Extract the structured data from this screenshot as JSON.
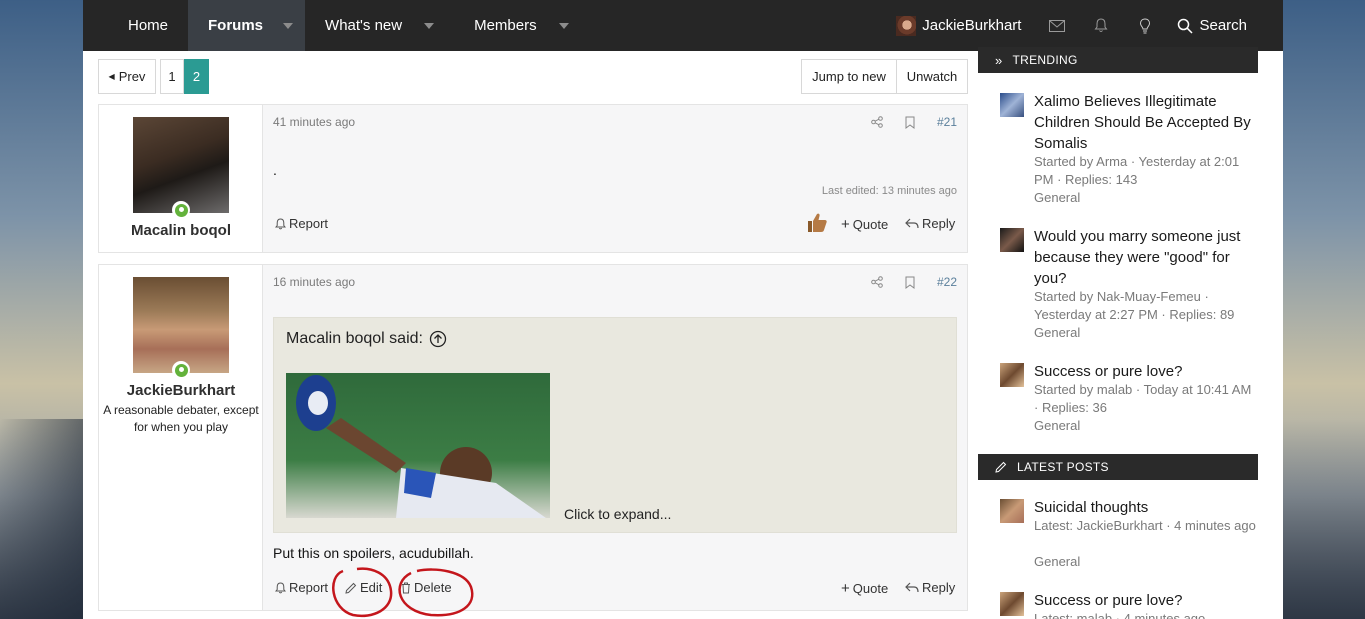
{
  "nav": {
    "items": [
      {
        "label": "Home"
      },
      {
        "label": "Forums"
      },
      {
        "label": "What's new"
      },
      {
        "label": "Members"
      }
    ],
    "username": "JackieBurkhart",
    "search_label": "Search"
  },
  "pager": {
    "prev": "Prev",
    "pages": [
      "1",
      "2"
    ],
    "jump": "Jump to new",
    "unwatch": "Unwatch"
  },
  "posts": [
    {
      "author": "Macalin boqol",
      "time": "41 minutes ago",
      "number": "#21",
      "message": ".",
      "edited": "Last edited: 13 minutes ago",
      "report": "Report",
      "quote": "Quote",
      "reply": "Reply"
    },
    {
      "author": "JackieBurkhart",
      "user_title": "A reasonable debater, except for when you play",
      "time": "16 minutes ago",
      "number": "#22",
      "quote_header": "Macalin boqol said:",
      "expand": "Click to expand...",
      "message": "Put this on spoilers, acudubillah.",
      "report": "Report",
      "edit": "Edit",
      "delete": "Delete",
      "quote": "Quote",
      "reply": "Reply"
    }
  ],
  "sidebar": {
    "trending_header": "TRENDING",
    "trending": [
      {
        "title": "Xalimo Believes Illegitimate Children Should Be Accepted By Somalis",
        "meta": "Started by Arma · Yesterday at 2:01 PM · Replies: 143",
        "forum": "General"
      },
      {
        "title": "Would you marry someone just because they were \"good\" for you?",
        "meta": "Started by Nak-Muay-Femeu · Yesterday at 2:27 PM · Replies: 89",
        "forum": "General"
      },
      {
        "title": "Success or pure love?",
        "meta": "Started by malab · Today at 10:41 AM · Replies: 36",
        "forum": "General"
      }
    ],
    "latest_header": "LATEST POSTS",
    "latest": [
      {
        "title": "Suicidal thoughts",
        "meta": "Latest: JackieBurkhart · 4 minutes ago",
        "forum": "General"
      },
      {
        "title": "Success or pure love?",
        "meta": "Latest: malab · 4 minutes ago"
      }
    ]
  }
}
